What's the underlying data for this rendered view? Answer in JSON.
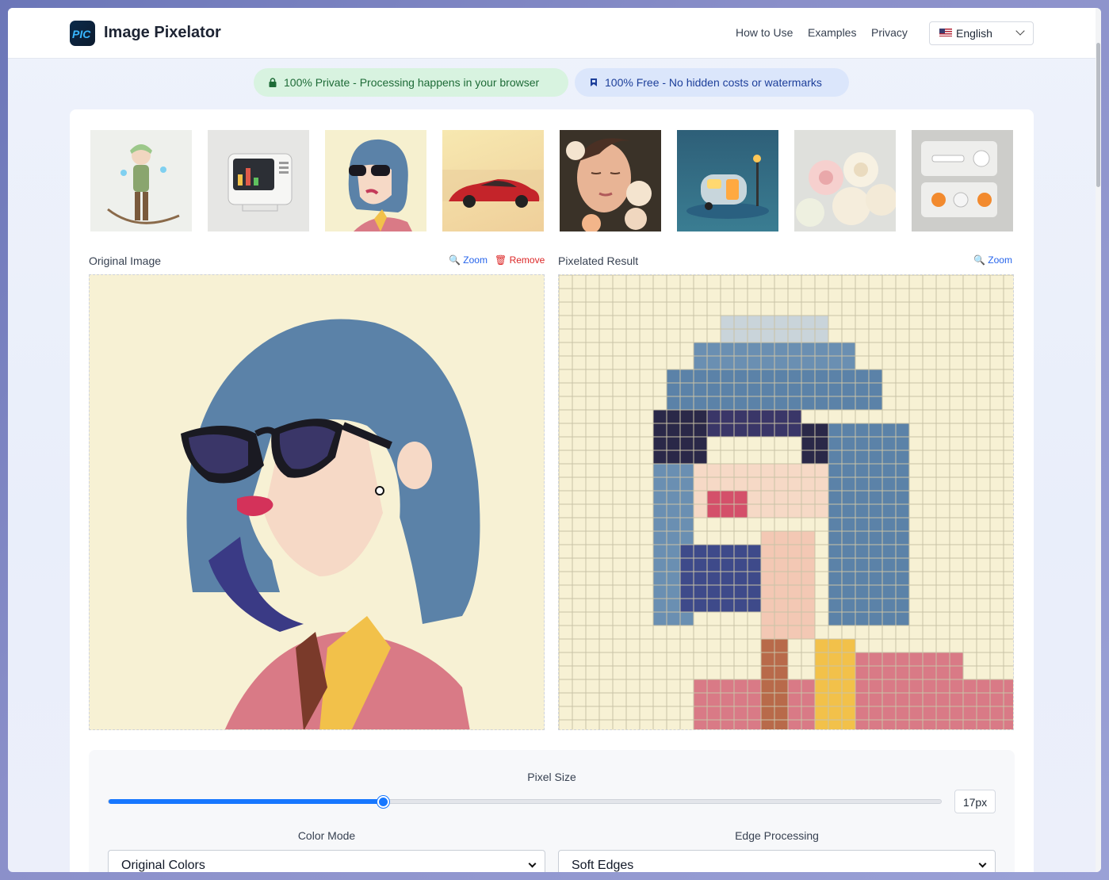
{
  "header": {
    "brand": "Image Pixelator",
    "logo_text": "PIC",
    "nav": [
      {
        "label": "How to Use"
      },
      {
        "label": "Examples"
      },
      {
        "label": "Privacy"
      }
    ],
    "language": {
      "label": "English",
      "flag_icon": "us-flag-icon"
    }
  },
  "badges": {
    "private": {
      "label": "100% Private - Processing happens in your browser",
      "icon": "lock-icon",
      "color": "#1e6b37"
    },
    "free": {
      "label": "100% Free - No hidden costs or watermarks",
      "icon": "bookmark-icon",
      "color": "#1d3f9a"
    }
  },
  "examples": [
    {
      "name": "example-archer-character"
    },
    {
      "name": "example-retro-computer"
    },
    {
      "name": "example-girl-sunglasses"
    },
    {
      "name": "example-red-sports-car"
    },
    {
      "name": "example-woman-flowers"
    },
    {
      "name": "example-camper-van"
    },
    {
      "name": "example-roses-bouquet"
    },
    {
      "name": "example-control-panel"
    }
  ],
  "original": {
    "title": "Original Image",
    "zoom_label": "Zoom",
    "remove_label": "Remove"
  },
  "result": {
    "title": "Pixelated Result",
    "zoom_label": "Zoom"
  },
  "controls": {
    "pixel_size_label": "Pixel Size",
    "pixel_size_value": "17px",
    "pixel_size_fraction": 0.33,
    "color_mode_label": "Color Mode",
    "color_mode_value": "Original Colors",
    "edge_label": "Edge Processing",
    "edge_value": "Soft Edges"
  },
  "colors": {
    "accent": "#1677ff",
    "zoom": "#2563eb",
    "remove": "#dc2626",
    "cream_bg": "#f7f1d4",
    "hair": "#5b82a8",
    "shirt": "#d97a86"
  }
}
